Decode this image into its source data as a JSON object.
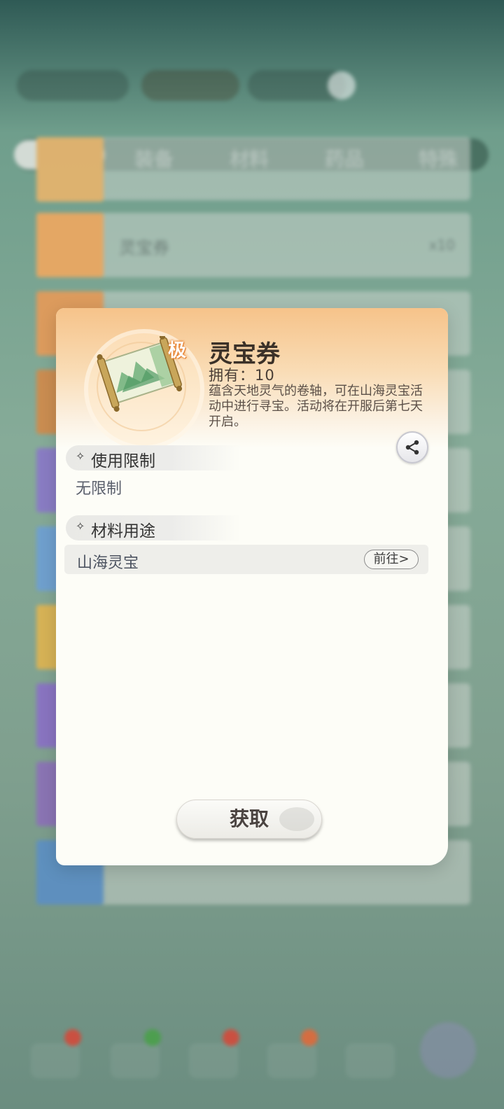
{
  "background": {
    "tabs": [
      "全部",
      "装备",
      "材料",
      "药品",
      "特殊"
    ],
    "active_tab_index": 0,
    "list_rows": [
      {
        "label": "",
        "count": ""
      },
      {
        "label": "灵宝券",
        "count": "x10"
      },
      {
        "label": "",
        "count": ""
      },
      {
        "label": "",
        "count": ""
      },
      {
        "label": "",
        "count": ""
      },
      {
        "label": "",
        "count": ""
      },
      {
        "label": "",
        "count": ""
      },
      {
        "label": "",
        "count": ""
      },
      {
        "label": "",
        "count": ""
      },
      {
        "label": "",
        "count": ""
      }
    ]
  },
  "modal": {
    "rarity": "极",
    "title": "灵宝券",
    "owned": "拥有：10",
    "description": "蕴含天地灵气的卷轴，可在山海灵宝活动中进行寻宝。活动将在开服后第七天开启。",
    "sections": {
      "limit": {
        "title": "使用限制",
        "text": "无限制"
      },
      "usage": {
        "title": "材料用途",
        "row_label": "山海灵宝",
        "goto_label": "前往>"
      }
    },
    "acquire_label": "获取",
    "icons": {
      "share": "share-icon",
      "diamond": "four-point-diamond-icon",
      "item": "scroll-icon"
    }
  },
  "colors": {
    "modal_header_orange": "#f6c38a",
    "modal_bg": "#fdfdf7",
    "rarity_orange": "#e57d2a"
  }
}
